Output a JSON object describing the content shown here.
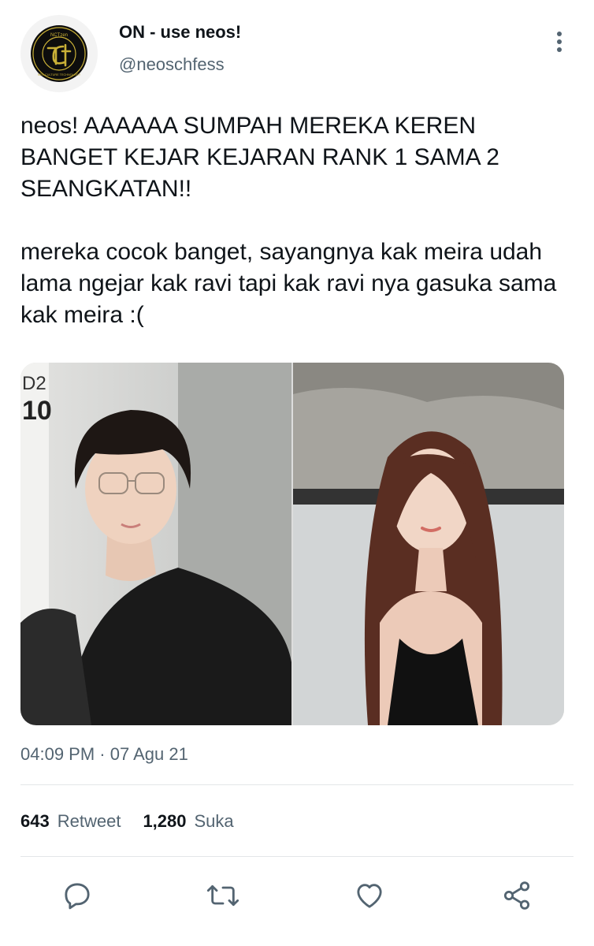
{
  "author": {
    "name": "ON - use neos!",
    "handle": "@neoschfess",
    "avatar_text_top": "NCTzen",
    "avatar_text_ring": "NEO CULTURE TECHNOLOGY"
  },
  "tweet": {
    "paragraphs": [
      "neos! AAAAAA SUMPAH MEREKA KEREN BANGET KEJAR KEJARAN RANK 1 SAMA 2 SEANGKATAN!!",
      "mereka cocok banget, sayangnya kak meira udah lama ngejar kak ravi tapi kak ravi nya gasuka sama kak meira :("
    ],
    "media": [
      {
        "sign_text_1": "D2",
        "sign_text_2": "10"
      },
      {}
    ],
    "timestamp": "04:09 PM · 07 Agu 21"
  },
  "stats": {
    "retweets_count": "643",
    "retweets_label": "Retweet",
    "likes_count": "1,280",
    "likes_label": "Suka"
  },
  "icons": [
    "more-vertical-icon",
    "reply-icon",
    "retweet-icon",
    "like-icon",
    "share-icon"
  ],
  "colors": {
    "text": "#0f1419",
    "secondary": "#536471",
    "divider": "#e3e6e8",
    "logo_gold": "#c9b037"
  }
}
